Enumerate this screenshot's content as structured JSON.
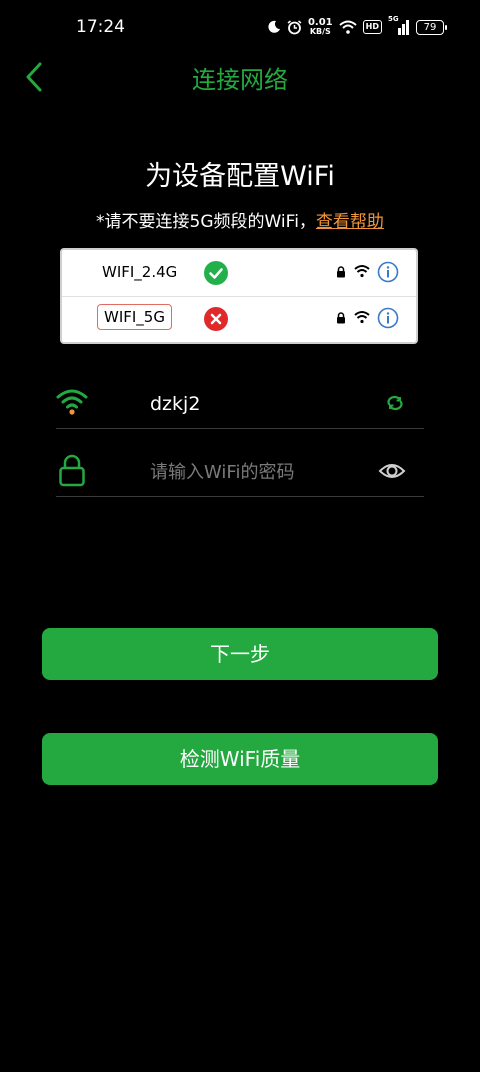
{
  "status_bar": {
    "time": "17:24",
    "speed_value": "0.01",
    "speed_unit": "KB/S",
    "hd_badge": "HD",
    "network_type": "5G",
    "battery": "79"
  },
  "header": {
    "back_icon": "chevron-left-icon",
    "title": "连接网络"
  },
  "heading": "为设备配置WiFi",
  "notice": {
    "text": "*请不要连接5G频段的WiFi，",
    "help_link": "查看帮助"
  },
  "example": {
    "rows": [
      {
        "ssid": "WIFI_2.4G",
        "status": "ok"
      },
      {
        "ssid": "WIFI_5G",
        "status": "bad"
      }
    ]
  },
  "form": {
    "ssid_value": "dzkj2",
    "password_placeholder": "请输入WiFi的密码"
  },
  "buttons": {
    "next": "下一步",
    "check": "检测WiFi质量"
  },
  "colors": {
    "accent": "#23a93f",
    "link": "#f0953a",
    "error": "#e02a2a",
    "ok": "#22b04a"
  }
}
